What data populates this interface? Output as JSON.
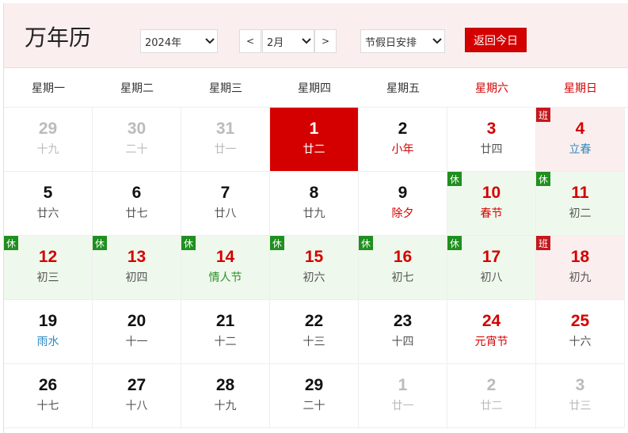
{
  "header": {
    "title": "万年历",
    "year_value": "2024年",
    "prev_label": "<",
    "month_value": "2月",
    "next_label": ">",
    "holiday_select": "节假日安排",
    "today_button": "返回今日"
  },
  "weekdays": [
    "星期一",
    "星期二",
    "星期三",
    "星期四",
    "星期五",
    "星期六",
    "星期日"
  ],
  "weeks": [
    [
      {
        "day": "29",
        "lunar": "十九",
        "state": "other"
      },
      {
        "day": "30",
        "lunar": "二十",
        "state": "other"
      },
      {
        "day": "31",
        "lunar": "廿一",
        "state": "other"
      },
      {
        "day": "1",
        "lunar": "廿二",
        "state": "today"
      },
      {
        "day": "2",
        "lunar": "小年",
        "lunar_style": "hl"
      },
      {
        "day": "3",
        "lunar": "廿四",
        "weekend": true
      },
      {
        "day": "4",
        "lunar": "立春",
        "weekend": true,
        "badge": "班",
        "lunar_style": "term"
      }
    ],
    [
      {
        "day": "5",
        "lunar": "廿六"
      },
      {
        "day": "6",
        "lunar": "廿七"
      },
      {
        "day": "7",
        "lunar": "廿八"
      },
      {
        "day": "8",
        "lunar": "廿九"
      },
      {
        "day": "9",
        "lunar": "除夕",
        "lunar_style": "hl"
      },
      {
        "day": "10",
        "lunar": "春节",
        "weekend": true,
        "badge": "休",
        "lunar_style": "hl"
      },
      {
        "day": "11",
        "lunar": "初二",
        "weekend": true,
        "badge": "休"
      }
    ],
    [
      {
        "day": "12",
        "lunar": "初三",
        "badge": "休"
      },
      {
        "day": "13",
        "lunar": "初四",
        "badge": "休"
      },
      {
        "day": "14",
        "lunar": "情人节",
        "badge": "休",
        "lunar_style": "fest-g"
      },
      {
        "day": "15",
        "lunar": "初六",
        "badge": "休"
      },
      {
        "day": "16",
        "lunar": "初七",
        "badge": "休"
      },
      {
        "day": "17",
        "lunar": "初八",
        "weekend": true,
        "badge": "休"
      },
      {
        "day": "18",
        "lunar": "初九",
        "weekend": true,
        "badge": "班"
      }
    ],
    [
      {
        "day": "19",
        "lunar": "雨水",
        "lunar_style": "term"
      },
      {
        "day": "20",
        "lunar": "十一"
      },
      {
        "day": "21",
        "lunar": "十二"
      },
      {
        "day": "22",
        "lunar": "十三"
      },
      {
        "day": "23",
        "lunar": "十四"
      },
      {
        "day": "24",
        "lunar": "元宵节",
        "weekend": true,
        "lunar_style": "hl"
      },
      {
        "day": "25",
        "lunar": "十六",
        "weekend": true
      }
    ],
    [
      {
        "day": "26",
        "lunar": "十七"
      },
      {
        "day": "27",
        "lunar": "十八"
      },
      {
        "day": "28",
        "lunar": "十九"
      },
      {
        "day": "29",
        "lunar": "二十"
      },
      {
        "day": "1",
        "lunar": "廿一",
        "state": "other"
      },
      {
        "day": "2",
        "lunar": "廿二",
        "state": "other"
      },
      {
        "day": "3",
        "lunar": "廿三",
        "state": "other"
      }
    ]
  ],
  "colors": {
    "accent": "#d40000",
    "rest_bg": "#eff8ec",
    "work_bg": "#fbeeee",
    "term": "#2e8bc0",
    "festival_green": "#2a8f2a"
  }
}
